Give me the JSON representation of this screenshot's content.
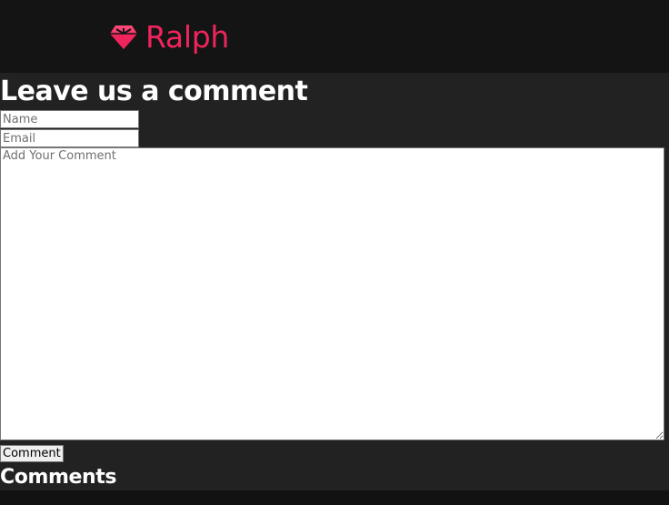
{
  "header": {
    "brand_name": "Ralph",
    "logo_icon": "gem-icon",
    "brand_color": "#f0245c"
  },
  "comment_form": {
    "title": "Leave us a comment",
    "name_placeholder": "Name",
    "email_placeholder": "Email",
    "comment_placeholder": "Add Your Comment",
    "submit_label": "Comment"
  },
  "comments": {
    "title": "Comments"
  }
}
